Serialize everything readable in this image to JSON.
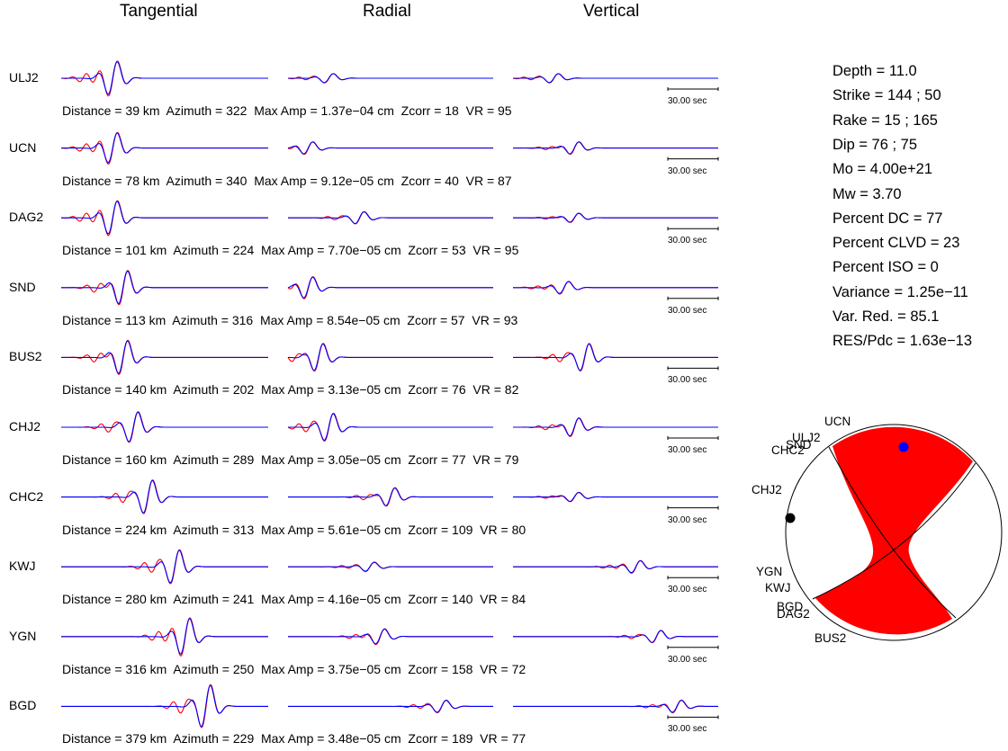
{
  "headers": [
    "Tangential",
    "Radial",
    "Vertical"
  ],
  "scale_label": "30.00 sec",
  "colors": {
    "observed": "#ff0000",
    "synthetic": "#0000ff",
    "compression": "#ff0000"
  },
  "source": [
    "Depth = 11.0",
    "Strike = 144 ; 50",
    "Rake = 15 ; 165",
    "Dip = 76 ; 75",
    "Mo = 4.00e+21",
    "Mw = 3.70",
    "Percent DC = 77",
    "Percent CLVD = 23",
    "Percent ISO = 0",
    "Variance = 1.25e−11",
    "Var. Red. = 85.1",
    "RES/Pdc = 1.63e−13"
  ],
  "beachball_labels": [
    "UCN",
    "ULJ2",
    "SND",
    "CHC2",
    "CHJ2",
    "YGN",
    "KWJ",
    "BGD",
    "DAG2",
    "BUS2"
  ],
  "chart_data": {
    "type": "line",
    "title": "",
    "series_legend": "none",
    "stations": [
      {
        "name": "ULJ2",
        "info": "Distance = 39 km  Azimuth = 322  Max Amp = 1.37e−04 cm  Zcorr = 18  VR = 95"
      },
      {
        "name": "UCN",
        "info": "Distance = 78 km  Azimuth = 340  Max Amp = 9.12e−05 cm  Zcorr = 40  VR = 87"
      },
      {
        "name": "DAG2",
        "info": "Distance = 101 km  Azimuth = 224  Max Amp = 7.70e−05 cm  Zcorr = 53  VR = 95"
      },
      {
        "name": "SND",
        "info": "Distance = 113 km  Azimuth = 316  Max Amp = 8.54e−05 cm  Zcorr = 57  VR = 93"
      },
      {
        "name": "BUS2",
        "info": "Distance = 140 km  Azimuth = 202  Max Amp = 3.13e−05 cm  Zcorr = 76  VR = 82"
      },
      {
        "name": "CHJ2",
        "info": "Distance = 160 km  Azimuth = 289  Max Amp = 3.05e−05 cm  Zcorr = 77  VR = 79"
      },
      {
        "name": "CHC2",
        "info": "Distance = 224 km  Azimuth = 313  Max Amp = 5.61e−05 cm  Zcorr = 109  VR = 80"
      },
      {
        "name": "KWJ",
        "info": "Distance = 280 km  Azimuth = 241  Max Amp = 4.16e−05 cm  Zcorr = 140  VR = 84"
      },
      {
        "name": "YGN",
        "info": "Distance = 316 km  Azimuth = 250  Max Amp = 3.75e−05 cm  Zcorr = 158  VR = 72"
      },
      {
        "name": "BGD",
        "info": "Distance = 379 km  Azimuth = 229  Max Amp = 3.48e−05 cm  Zcorr = 189  VR = 77"
      }
    ]
  }
}
